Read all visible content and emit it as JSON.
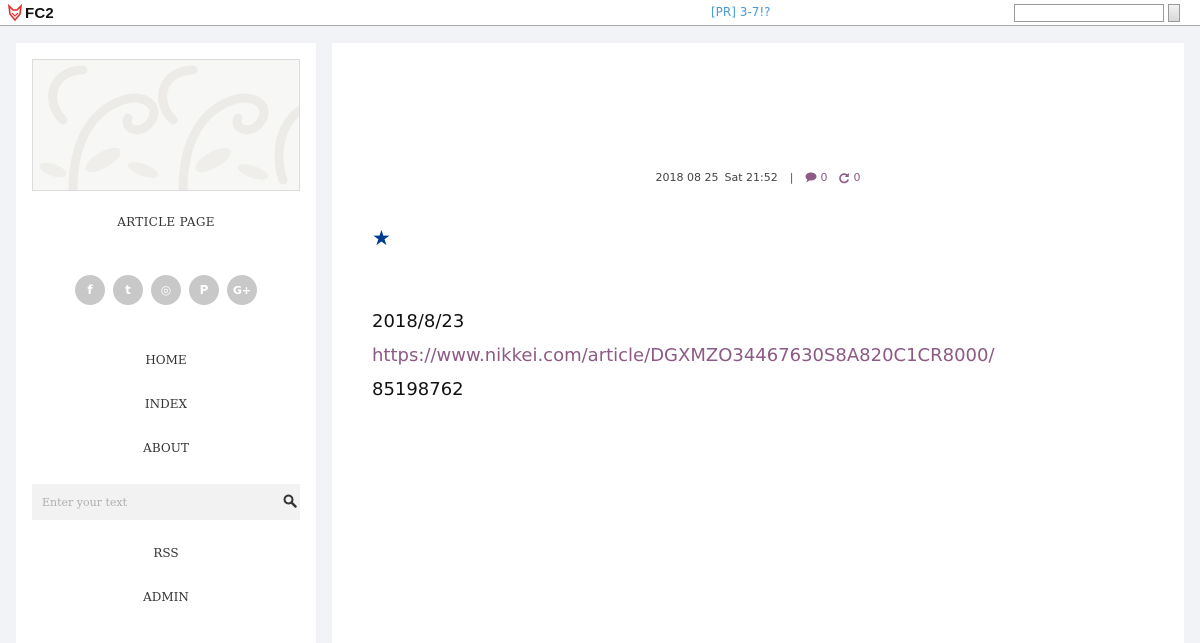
{
  "topbar": {
    "brand": "FC2",
    "pr_text": "[PR] 3-7!?",
    "search_value": ""
  },
  "sidebar": {
    "blog_title": "ARTICLE PAGE",
    "social": [
      {
        "icon": "facebook-icon",
        "glyph": "f"
      },
      {
        "icon": "twitter-icon",
        "glyph": "t"
      },
      {
        "icon": "instagram-icon",
        "glyph": "◎"
      },
      {
        "icon": "pinterest-icon",
        "glyph": "P"
      },
      {
        "icon": "google-plus-icon",
        "glyph": "G+"
      }
    ],
    "nav": {
      "home": "HOME",
      "index": "INDEX",
      "about": "ABOUT",
      "rss": "RSS",
      "admin": "ADMIN"
    },
    "search_placeholder": "Enter your text"
  },
  "article": {
    "date": "2018 08 25",
    "day_time": "Sat 21:52",
    "separator": "|",
    "comment_count": "0",
    "trackback_count": "0",
    "star": "★",
    "line_date": "2018/8/23",
    "link": "https://www.nikkei.com/article/DGXMZO34467630S8A820C1CR8000/",
    "number": "85198762"
  },
  "colors": {
    "accent": "#8c5a84",
    "star": "#003b8e",
    "pr_link": "#4a9ad6",
    "page_bg": "#f1f3f6"
  }
}
